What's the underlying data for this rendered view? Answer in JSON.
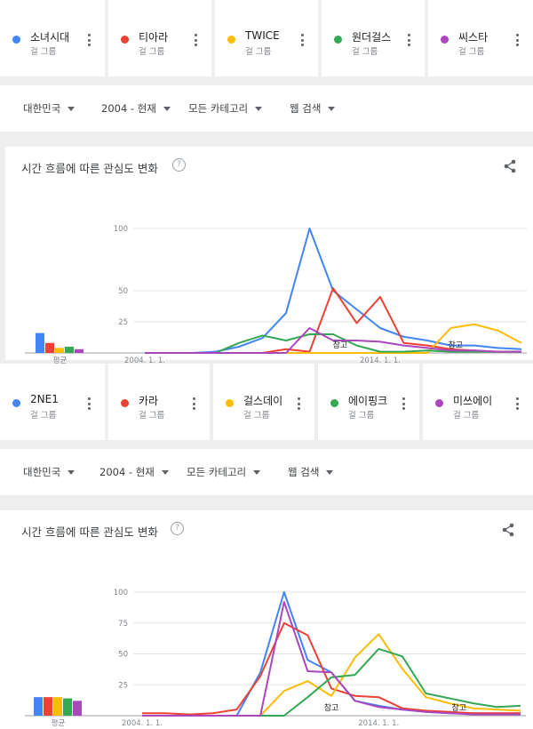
{
  "sections": [
    {
      "terms": [
        {
          "name": "소녀시대",
          "category": "걸 그룹",
          "color": "#4285f4"
        },
        {
          "name": "티아라",
          "category": "걸 그룹",
          "color": "#ea4335"
        },
        {
          "name": "TWICE",
          "category": "걸 그룹",
          "color": "#fbbc04"
        },
        {
          "name": "원더걸스",
          "category": "걸 그룹",
          "color": "#34a853"
        },
        {
          "name": "씨스타",
          "category": "걸 그룹",
          "color": "#ab47bc"
        }
      ],
      "filters": {
        "region": "대한민국",
        "period": "2004 - 현재",
        "category": "모든 카테고리",
        "search_type": "웹 검색"
      },
      "panel_title": "시간 흐름에 따른 관심도 변화",
      "help_glyph": "?",
      "average_label": "평균",
      "note_label": "참고"
    },
    {
      "terms": [
        {
          "name": "2NE1",
          "category": "걸 그룹",
          "color": "#4285f4"
        },
        {
          "name": "카라",
          "category": "걸 그룹",
          "color": "#ea4335"
        },
        {
          "name": "걸스데이",
          "category": "걸 그룹",
          "color": "#fbbc04"
        },
        {
          "name": "에이핑크",
          "category": "걸 그룹",
          "color": "#34a853"
        },
        {
          "name": "미쓰에이",
          "category": "걸 그룹",
          "color": "#ab47bc"
        }
      ],
      "filters": {
        "region": "대한민국",
        "period": "2004 - 현재",
        "category": "모든 카테고리",
        "search_type": "웹 검색"
      },
      "panel_title": "시간 흐름에 따른 관심도 변화",
      "help_glyph": "?",
      "average_label": "평균",
      "note_label": "참고"
    }
  ],
  "chart_data": [
    {
      "type": "line",
      "title": "시간 흐름에 따른 관심도 변화",
      "y_ticks": [
        25,
        50,
        100
      ],
      "x_ticks": [
        "2004. 1. 1.",
        "2014. 1. 1."
      ],
      "ylim": [
        0,
        100
      ],
      "x": [
        2004,
        2005,
        2006,
        2007,
        2008,
        2009,
        2010,
        2011,
        2012,
        2013,
        2014,
        2015,
        2016,
        2017,
        2018,
        2019,
        2020
      ],
      "series": [
        {
          "name": "소녀시대",
          "color": "#4285f4",
          "values": [
            0,
            0,
            0,
            1,
            5,
            12,
            32,
            100,
            50,
            35,
            20,
            13,
            10,
            6,
            6,
            4,
            3
          ]
        },
        {
          "name": "티아라",
          "color": "#ea4335",
          "values": [
            0,
            0,
            0,
            0,
            0,
            0,
            3,
            1,
            52,
            24,
            45,
            8,
            6,
            3,
            2,
            1,
            1
          ]
        },
        {
          "name": "TWICE",
          "color": "#fbbc04",
          "values": [
            0,
            0,
            0,
            0,
            0,
            0,
            0,
            0,
            0,
            0,
            0,
            0,
            0,
            20,
            23,
            18,
            8
          ]
        },
        {
          "name": "원더걸스",
          "color": "#34a853",
          "values": [
            0,
            0,
            0,
            0,
            8,
            14,
            10,
            15,
            15,
            6,
            1,
            1,
            2,
            1,
            1,
            1,
            1
          ]
        },
        {
          "name": "씨스타",
          "color": "#ab47bc",
          "values": [
            0,
            0,
            0,
            0,
            0,
            0,
            0,
            20,
            10,
            10,
            9,
            6,
            4,
            2,
            2,
            1,
            1
          ]
        }
      ],
      "average": [
        16,
        8,
        4,
        5,
        3
      ],
      "notes": [
        2012.3,
        2017.2
      ]
    },
    {
      "type": "line",
      "title": "시간 흐름에 따른 관심도 변화",
      "y_ticks": [
        25,
        50,
        75,
        100
      ],
      "x_ticks": [
        "2004. 1. 1.",
        "2014. 1. 1."
      ],
      "ylim": [
        0,
        100
      ],
      "x": [
        2004,
        2005,
        2006,
        2007,
        2008,
        2009,
        2010,
        2011,
        2012,
        2013,
        2014,
        2015,
        2016,
        2017,
        2018,
        2019,
        2020
      ],
      "series": [
        {
          "name": "2NE1",
          "color": "#4285f4",
          "values": [
            0,
            0,
            0,
            0,
            0,
            35,
            100,
            45,
            35,
            12,
            8,
            5,
            3,
            2,
            2,
            2,
            2
          ]
        },
        {
          "name": "카라",
          "color": "#ea4335",
          "values": [
            2,
            2,
            1,
            2,
            5,
            32,
            75,
            65,
            22,
            16,
            15,
            6,
            4,
            3,
            2,
            2,
            2
          ]
        },
        {
          "name": "걸스데이",
          "color": "#fbbc04",
          "values": [
            0,
            0,
            0,
            0,
            0,
            0,
            20,
            28,
            16,
            47,
            66,
            38,
            15,
            10,
            6,
            5,
            4
          ]
        },
        {
          "name": "에이핑크",
          "color": "#34a853",
          "values": [
            0,
            0,
            0,
            0,
            0,
            0,
            0,
            15,
            31,
            33,
            54,
            48,
            18,
            14,
            10,
            7,
            8
          ]
        },
        {
          "name": "미쓰에이",
          "color": "#ab47bc",
          "values": [
            0,
            0,
            0,
            0,
            0,
            0,
            92,
            36,
            35,
            12,
            7,
            5,
            3,
            2,
            1,
            1,
            1
          ]
        }
      ],
      "average": [
        15,
        15,
        15,
        14,
        12
      ],
      "notes": [
        2012.0,
        2017.4
      ]
    }
  ]
}
